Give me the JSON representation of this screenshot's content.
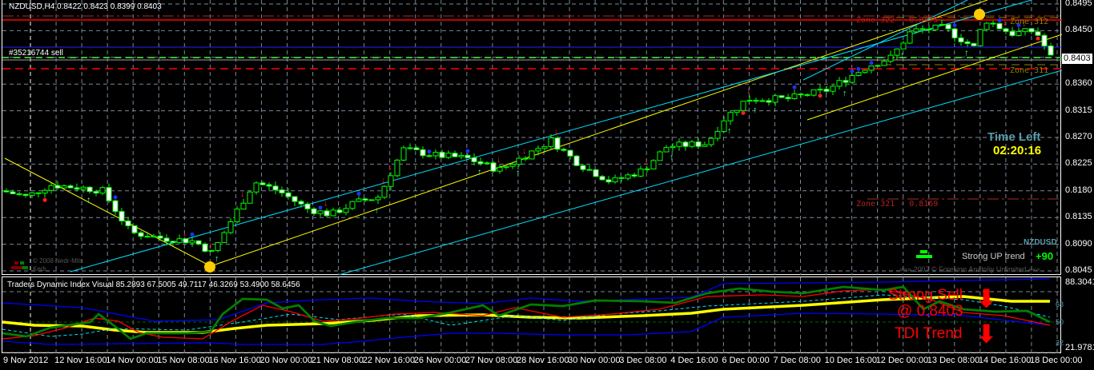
{
  "header": {
    "symbol_info": "NZDUSD,H4  0.8422 0.8423 0.8399 0.8403"
  },
  "order": {
    "label": "#35216744 sell"
  },
  "zones": {
    "z322": "Zone 322 - 0.8475",
    "z312": "Zone 312",
    "z311": "Zone 311",
    "z321": "Zone 321 - 0.8169"
  },
  "price_axis": [
    "0.8495",
    "0.8450",
    "0.8360",
    "0.8315",
    "0.8270",
    "0.8225",
    "0.8180",
    "0.8135",
    "0.8090",
    "0.8045"
  ],
  "current_price": "0.8403",
  "timer": {
    "title": "Time Left",
    "value": "02:20:16"
  },
  "trend_widget": {
    "symbol": "NZDUSD",
    "text": "Strong UP trend",
    "value": "+90",
    "copyright": "»»»  2007 © Forexinn Anatoliy Unlimited  «««"
  },
  "watermark": {
    "line1": "© 2008 Nedr-Mits",
    "line2": "Kedr"
  },
  "tdi": {
    "title": "Traders Dynamic Index Visual 85.2893 67.5005 49.7117 46.3269 53.4900 58.6456",
    "max": "88.3041",
    "min": "21.9781",
    "levels": [
      "68",
      "50",
      "32"
    ],
    "signal1": "Strong Sell",
    "signal2": "@ 0.8403",
    "signal3": "TDI Trend"
  },
  "time_axis": [
    "9 Nov 2012",
    "12 Nov 16:00",
    "14 Nov 00:00",
    "15 Nov 08:00",
    "16 Nov 16:00",
    "20 Nov 00:00",
    "21 Nov 08:00",
    "22 Nov 16:00",
    "26 Nov 00:00",
    "27 Nov 08:00",
    "28 Nov 16:00",
    "30 Nov 00:00",
    "3 Dec 08:00",
    "4 Dec 16:00",
    "6 Dec 00:00",
    "7 Dec 08:00",
    "10 Dec 16:00",
    "12 Dec 00:00",
    "13 Dec 08:00",
    "14 Dec 16:00",
    "18 Dec 00:00"
  ],
  "colors": {
    "bull": "#00ff00",
    "bear": "#ffffff",
    "grid": "#8090a0"
  },
  "price_path": [
    [
      0,
      0.818
    ],
    [
      30,
      0.817
    ],
    [
      60,
      0.819
    ],
    [
      100,
      0.8185
    ],
    [
      125,
      0.818
    ],
    [
      160,
      0.811
    ],
    [
      200,
      0.81
    ],
    [
      240,
      0.8095
    ],
    [
      262,
      0.8075
    ],
    [
      290,
      0.814
    ],
    [
      315,
      0.8195
    ],
    [
      345,
      0.818
    ],
    [
      380,
      0.815
    ],
    [
      410,
      0.814
    ],
    [
      440,
      0.816
    ],
    [
      470,
      0.817
    ],
    [
      500,
      0.825
    ],
    [
      540,
      0.824
    ],
    [
      580,
      0.8235
    ],
    [
      620,
      0.8215
    ],
    [
      660,
      0.8245
    ],
    [
      685,
      0.8265
    ],
    [
      720,
      0.8225
    ],
    [
      760,
      0.8195
    ],
    [
      800,
      0.8215
    ],
    [
      830,
      0.8255
    ],
    [
      880,
      0.826
    ],
    [
      900,
      0.83
    ],
    [
      930,
      0.8335
    ],
    [
      980,
      0.8335
    ],
    [
      1030,
      0.835
    ],
    [
      1080,
      0.839
    ],
    [
      1110,
      0.8405
    ],
    [
      1135,
      0.845
    ],
    [
      1175,
      0.8455
    ],
    [
      1215,
      0.842
    ],
    [
      1225,
      0.847
    ],
    [
      1260,
      0.8445
    ],
    [
      1290,
      0.845
    ],
    [
      1310,
      0.8403
    ]
  ]
}
